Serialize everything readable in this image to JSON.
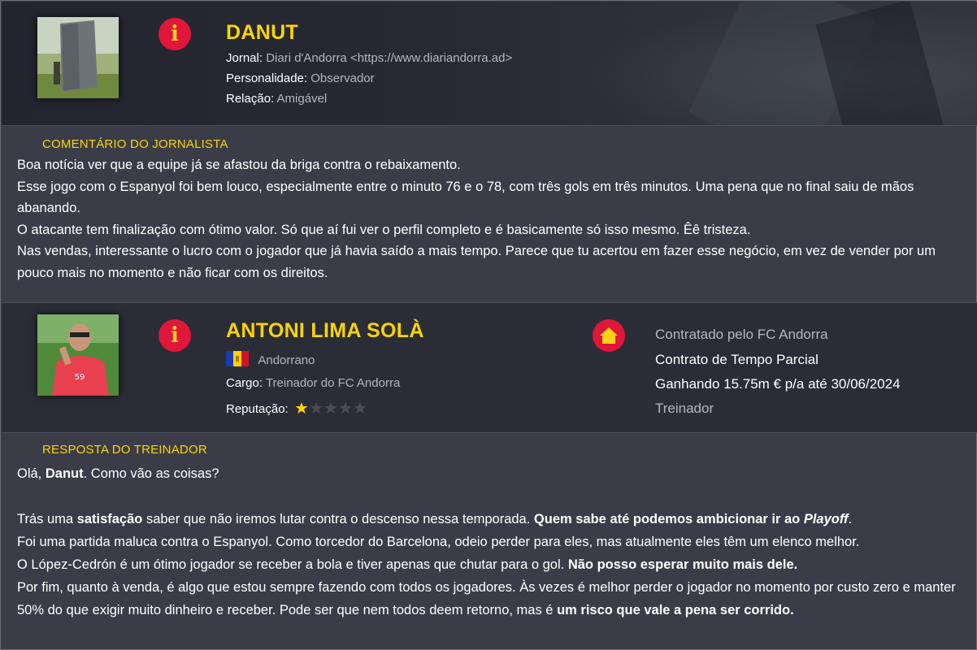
{
  "journalist": {
    "name": "DANUT",
    "journal_label": "Jornal:",
    "journal_value": "Diari d'Andorra <https://www.diariandorra.ad>",
    "personality_label": "Personalidade:",
    "personality_value": "Observador",
    "relation_label": "Relação:",
    "relation_value": "Amigável",
    "photo_icon": "journalist-photo"
  },
  "comment": {
    "label": "COMENTÁRIO DO JORNALISTA",
    "lines": [
      "Boa notícia ver que a equipe já se afastou da briga contra o rebaixamento.",
      "Esse jogo com o Espanyol foi bem louco, especialmente entre o minuto 76 e o 78, com três gols em três minutos. Uma pena que no final saiu de mãos abanando.",
      "O atacante tem finalização com ótimo valor. Só que aí fui ver o perfil completo e é basicamente só isso mesmo. Êê tristeza.",
      "Nas vendas, interessante o lucro com o jogador que já havia saído a mais tempo. Parece que tu acertou em fazer esse negócio, em vez de vender por um pouco mais no momento e não ficar com os direitos."
    ]
  },
  "coach": {
    "name": "ANTONI LIMA SOLÀ",
    "nationality": "Andorrano",
    "role_label": "Cargo:",
    "role_value": "Treinador do FC Andorra",
    "reputation_label": "Reputação:",
    "reputation_stars": 1,
    "reputation_max": 5,
    "contract": {
      "hired_by": "Contratado pelo FC Andorra",
      "type": "Contrato de Tempo Parcial",
      "salary": "Ganhando 15.75m € p/a até 30/06/2024",
      "position": "Treinador"
    },
    "colors": {
      "accent_red": "#e0163a",
      "accent_yellow": "#ffd400"
    }
  },
  "reply": {
    "label": "RESPOSTA DO TREINADOR",
    "greeting_pre": "Olá, ",
    "greeting_name": "Danut",
    "greeting_post": ". Como vão as coisas?",
    "p1_a": "Trás uma ",
    "p1_b": "satisfação",
    "p1_c": " saber que não iremos lutar contra o descenso nessa temporada. ",
    "p1_d": "Quem sabe até podemos ambicionar ir ao ",
    "p1_e": "Playoff",
    "p1_f": ".",
    "p2": "Foi uma partida maluca contra o Espanyol. Como torcedor do Barcelona, odeio perder para eles, mas atualmente eles têm um elenco melhor.",
    "p3_a": "O López-Cedrón é um ótimo jogador se receber a bola e tiver apenas que chutar para o gol. ",
    "p3_b": "Não posso esperar muito mais dele.",
    "p4_a": "Por fim, quanto à venda, é algo que estou sempre fazendo com todos os jogadores. Às vezes é melhor perder o jogador no momento por custo zero e manter 50% do que exigir muito dinheiro e receber. Pode ser que nem todos deem retorno, mas é ",
    "p4_b": "um risco que vale a pena ser corrido."
  }
}
